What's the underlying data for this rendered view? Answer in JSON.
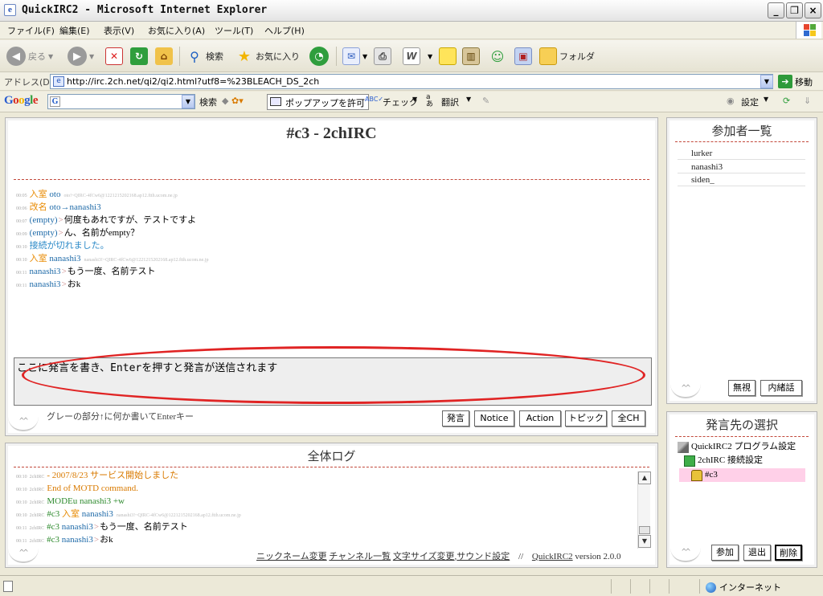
{
  "window": {
    "title": "QuickIRC2 - Microsoft Internet Explorer"
  },
  "menu": [
    "ファイル(F)",
    "編集(E)",
    "表示(V)",
    "お気に入り(A)",
    "ツール(T)",
    "ヘルプ(H)"
  ],
  "toolbar": {
    "back": "戻る",
    "search": "検索",
    "favorites": "お気に入り",
    "folders": "フォルダ"
  },
  "address": {
    "label": "アドレス(D)",
    "url": "http://irc.2ch.net/qi2/qi2.html?utf8=%23BLEACH_DS_2ch",
    "go": "移動"
  },
  "googlebar": {
    "logo": "Google",
    "search": "検索",
    "popup": "ポップアップを許可",
    "check": "チェック",
    "translate": "翻訳",
    "settings": "設定"
  },
  "chat": {
    "title": "#c3 - 2chIRC",
    "lines": [
      {
        "time": "00:05",
        "parts": [
          {
            "t": "入室",
            "c": "c-join"
          },
          {
            "t": " oto",
            "c": "c-nick"
          },
          {
            "t": "oto!~QIRC-4fCw6@1221215202168.ap12.ftth.ucom.ne.jp",
            "c": "c-host"
          }
        ]
      },
      {
        "time": "00:06",
        "parts": [
          {
            "t": "改名",
            "c": "c-join"
          },
          {
            "t": " oto→nanashi3",
            "c": "c-nick"
          }
        ]
      },
      {
        "time": "00:07",
        "parts": [
          {
            "t": "(empty)",
            "c": "c-nick"
          },
          {
            "t": ">",
            "c": "c-sep"
          },
          {
            "t": "何度もあれですが、テストですよ",
            "c": "c-text"
          }
        ]
      },
      {
        "time": "00:09",
        "parts": [
          {
            "t": "(empty)",
            "c": "c-nick"
          },
          {
            "t": ">",
            "c": "c-sep"
          },
          {
            "t": "ん、名前がempty？",
            "c": "c-text"
          }
        ]
      },
      {
        "time": "00:10",
        "parts": [
          {
            "t": "接続が切れました。",
            "c": "c-blue"
          }
        ]
      },
      {
        "time": "00:10",
        "parts": [
          {
            "t": "入室",
            "c": "c-join"
          },
          {
            "t": " nanashi3",
            "c": "c-nick"
          },
          {
            "t": "nanashi3!~QIRC-4fCw6@1221215202168.ap12.ftth.ucom.ne.jp",
            "c": "c-host"
          }
        ]
      },
      {
        "time": "00:11",
        "parts": [
          {
            "t": "nanashi3",
            "c": "c-nick"
          },
          {
            "t": ">",
            "c": "c-sep"
          },
          {
            "t": "もう一度、名前テスト",
            "c": "c-text"
          }
        ]
      },
      {
        "time": "00:11",
        "parts": [
          {
            "t": "nanashi3",
            "c": "c-nick"
          },
          {
            "t": ">",
            "c": "c-sep"
          },
          {
            "t": "おk",
            "c": "c-text"
          }
        ]
      }
    ],
    "input_value": "ここに発言を書き、Enterを押すと発言が送信されます",
    "hint": "グレーの部分↑に何か書いてEnterキー",
    "buttons": [
      "発言",
      "Notice",
      "Action",
      "トピック",
      "全CH"
    ]
  },
  "users": {
    "title": "参加者一覧",
    "list": [
      "lurker",
      "nanashi3",
      "siden_"
    ],
    "buttons": [
      "無視",
      "内緒話"
    ]
  },
  "targets": {
    "title": "発言先の選択",
    "items": [
      "QuickIRC2 プログラム設定",
      "2chIRC 接続設定",
      "#c3"
    ],
    "buttons": [
      "参加",
      "退出",
      "削除"
    ]
  },
  "log": {
    "title": "全体ログ",
    "lines": [
      {
        "time": "00:10",
        "src": "2chIRC",
        "parts": [
          {
            "t": "- 2007/8/23 サービス開始しました",
            "c": "c-orange"
          }
        ]
      },
      {
        "time": "00:10",
        "src": "2chIRC",
        "parts": [
          {
            "t": "End of MOTD command.",
            "c": "c-orange"
          }
        ]
      },
      {
        "time": "00:10",
        "src": "2chIRC",
        "parts": [
          {
            "t": "MODE",
            "c": "c-green"
          },
          {
            "t": "u nanashi3 +w",
            "c": "c-green"
          }
        ]
      },
      {
        "time": "00:10",
        "src": "2chIRC",
        "parts": [
          {
            "t": "#c3 ",
            "c": "c-chan"
          },
          {
            "t": "入室",
            "c": "c-join"
          },
          {
            "t": " nanashi3",
            "c": "c-nick"
          },
          {
            "t": "nanashi3!~QIRC-4fCw6@1221215202168.ap12.ftth.ucom.ne.jp",
            "c": "c-host"
          }
        ]
      },
      {
        "time": "00:11",
        "src": "2chIRC",
        "parts": [
          {
            "t": "#c3 ",
            "c": "c-chan"
          },
          {
            "t": "nanashi3",
            "c": "c-nick"
          },
          {
            "t": ">",
            "c": "c-sep"
          },
          {
            "t": "もう一度、名前テスト",
            "c": "c-text"
          }
        ]
      },
      {
        "time": "00:11",
        "src": "2chIRC",
        "parts": [
          {
            "t": "#c3 ",
            "c": "c-chan"
          },
          {
            "t": "nanashi3",
            "c": "c-nick"
          },
          {
            "t": ">",
            "c": "c-sep"
          },
          {
            "t": "おk",
            "c": "c-text"
          }
        ]
      }
    ],
    "footer_links": [
      "ニックネーム変更",
      "チャンネル一覧",
      "文字サイズ変更",
      "サウンド設定"
    ],
    "footer_sep": "//",
    "app_link": "QuickIRC2",
    "version": "version 2.0.0"
  },
  "status": {
    "zone": "インターネット"
  },
  "colors": {
    "annotation": "#e02424",
    "divider": "#c2483a",
    "selected_target": "#ffd0e8"
  }
}
